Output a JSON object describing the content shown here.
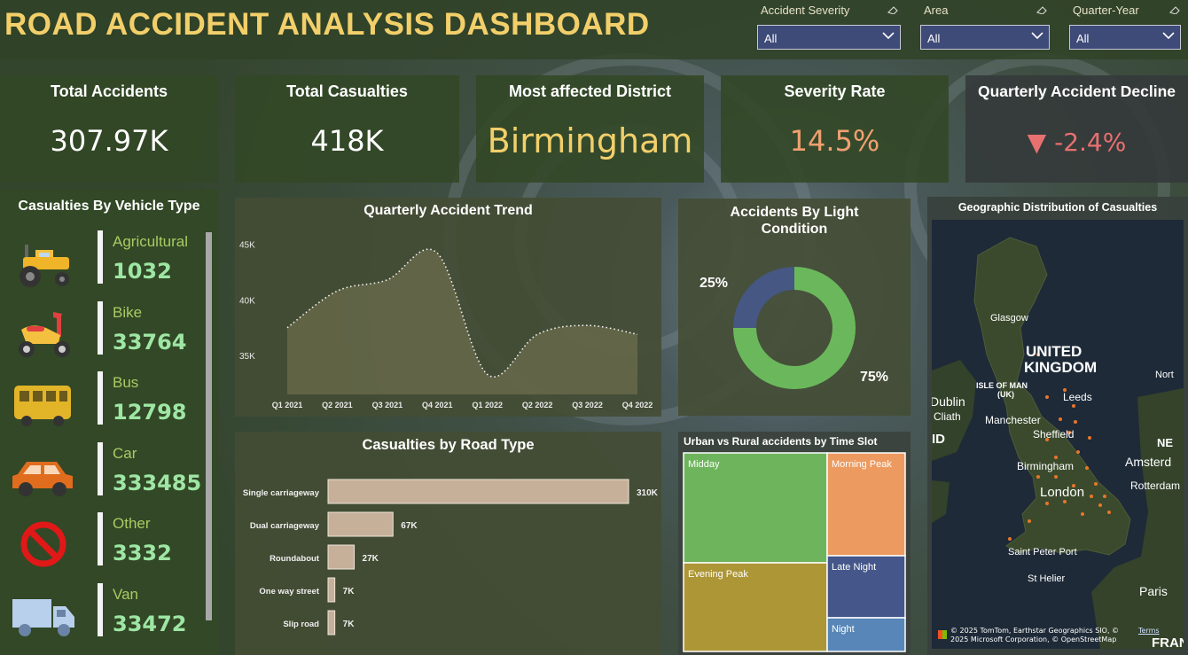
{
  "header": {
    "title": "ROAD ACCIDENT ANALYSIS DASHBOARD"
  },
  "filters": [
    {
      "label": "Accident Severity",
      "value": "All"
    },
    {
      "label": "Area",
      "value": "All"
    },
    {
      "label": "Quarter-Year",
      "value": "All"
    }
  ],
  "kpis": {
    "total_accidents": {
      "title": "Total Accidents",
      "value": "307.97K"
    },
    "total_casualties": {
      "title": "Total Casualties",
      "value": "418K"
    },
    "district": {
      "title": "Most affected District",
      "value": "Birmingham"
    },
    "severity": {
      "title": "Severity Rate",
      "value": "14.5%"
    },
    "decline": {
      "title": "Quarterly Accident Decline",
      "arrow": "▼",
      "value": "-2.4%"
    }
  },
  "vehicles": {
    "title": "Casualties By Vehicle Type",
    "items": [
      {
        "name": "Agricultural",
        "value": "1032",
        "icon": "tractor-icon"
      },
      {
        "name": "Bike",
        "value": "33764",
        "icon": "scooter-icon"
      },
      {
        "name": "Bus",
        "value": "12798",
        "icon": "bus-icon"
      },
      {
        "name": "Car",
        "value": "333485",
        "icon": "car-icon"
      },
      {
        "name": "Other",
        "value": "3332",
        "icon": "prohibited-icon"
      },
      {
        "name": "Van",
        "value": "33472",
        "icon": "van-icon"
      }
    ]
  },
  "trend_title": "Quarterly Accident Trend",
  "light_title": "Accidents By Light Condition",
  "road_title": "Casualties by Road Type",
  "treemap_title": "Urban vs Rural accidents by Time Slot",
  "map": {
    "title": "Geographic Distribution of Casualties",
    "places": [
      "Glasgow",
      "UNITED",
      "KINGDOM",
      "ISLE OF MAN",
      "(UK)",
      "Leeds",
      "Dublin",
      "Cliath",
      "Manchester",
      "Sheffield",
      "Birmingham",
      "London",
      "Amsterd",
      "Rotterdam",
      "Saint Peter Port",
      "St Helier",
      "Paris",
      "Nort",
      "NE",
      "ID",
      "FRANC"
    ],
    "attribution": "© 2025 TomTom, Earthstar Geographics SIO, © 2025 Microsoft Corporation, © OpenStreetMap",
    "terms": "Terms"
  },
  "chart_data": [
    {
      "type": "area",
      "title": "Quarterly Accident Trend",
      "x": [
        "Q1 2021",
        "Q2 2021",
        "Q3 2021",
        "Q4 2021",
        "Q1 2022",
        "Q2 2022",
        "Q3 2022",
        "Q4 2022"
      ],
      "y": [
        37500,
        40800,
        41800,
        44200,
        33300,
        36900,
        37700,
        36900
      ],
      "yticks": [
        "35K",
        "40K",
        "45K"
      ],
      "ylim": [
        31500,
        46000
      ]
    },
    {
      "type": "pie",
      "title": "Accidents By Light Condition",
      "values": [
        75,
        25
      ],
      "labels": [
        "75%",
        "25%"
      ],
      "colors": [
        "#6bb85c",
        "#455782"
      ]
    },
    {
      "type": "bar",
      "title": "Casualties by Road Type",
      "categories": [
        "Single carriageway",
        "Dual carriageway",
        "Roundabout",
        "One way street",
        "Slip road"
      ],
      "values": [
        310,
        67,
        27,
        7,
        7
      ],
      "labels": [
        "310K",
        "67K",
        "27K",
        "7K",
        "7K"
      ]
    },
    {
      "type": "heatmap",
      "title": "Urban vs Rural accidents by Time Slot",
      "items": [
        {
          "name": "Midday",
          "color": "#6eb45c"
        },
        {
          "name": "Evening Peak",
          "color": "#ad9636"
        },
        {
          "name": "Morning Peak",
          "color": "#ec9a60"
        },
        {
          "name": "Late Night",
          "color": "#45578a"
        },
        {
          "name": "Night",
          "color": "#5886b8"
        }
      ]
    }
  ]
}
